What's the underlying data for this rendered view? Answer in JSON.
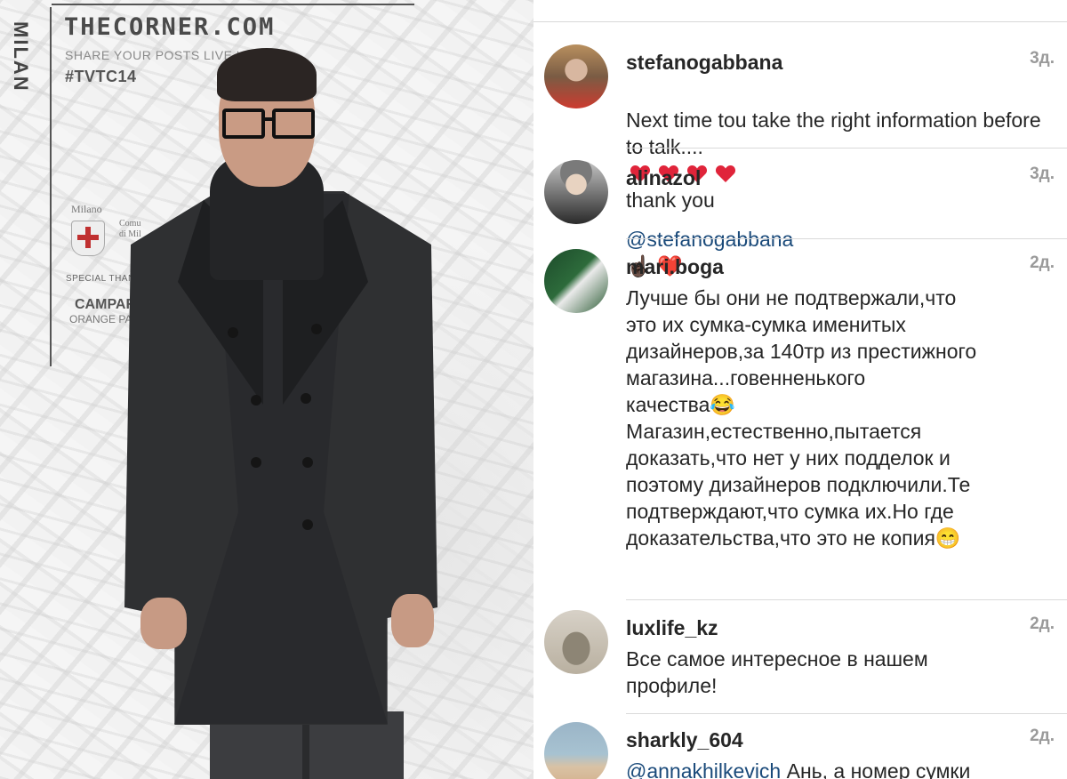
{
  "photo": {
    "vertical_label": "MILAN",
    "brand": "THECORNER.COM",
    "share_line": "SHARE YOUR POSTS LIVE USING",
    "hashtag": "#TVTC14",
    "milano": "Milano",
    "comune": "Comu\ndi Mil",
    "special_thanks": "SPECIAL THANKS T",
    "sponsor": "CAMPAR",
    "sponsor_sub": "ORANGE PASS"
  },
  "comments": [
    {
      "username": "stefanogabbana",
      "time": "3д.",
      "text_before": "Next time tou take the right information before to talk....",
      "hearts": 4,
      "text_after": "thank you"
    },
    {
      "username": "alinazol",
      "time": "3д.",
      "mention": "@stefanogabbana",
      "emoji": "☝🏿 ❤️"
    },
    {
      "username": "mari.boga",
      "time": "2д.",
      "text": "Лучше бы они не подтвержали,что\nэто их сумка-сумка именитых\nдизайнеров,за 140тр из престижного\nмагазина...говенненького\nкачества😂\nМагазин,естественно,пытается\nдоказать,что нет у них подделок и\nпоэтому дизайнеров подключили.Те\nподтверждают,что сумка их.Но где\nдоказательства,что это не копия😁"
    },
    {
      "username": "luxlife_kz",
      "time": "2д.",
      "text": "Все самое интересное в нашем\nпрофиле!"
    },
    {
      "username": "sharkly_604",
      "time": "2д.",
      "mention": "@annakhilkevich",
      "text": " Ань, а номер сумки"
    }
  ],
  "colors": {
    "username": "#262626",
    "time": "#9a9a9a",
    "mention": "#1a4a7a",
    "heart": "#e0243a"
  }
}
